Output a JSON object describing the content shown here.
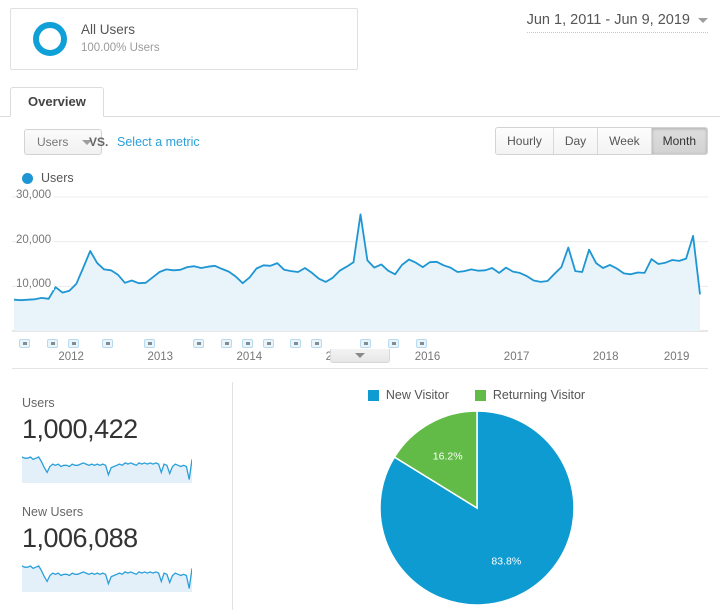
{
  "segment": {
    "name": "All Users",
    "subtitle": "100.00% Users",
    "ring_color": "#0fa0d8",
    "icon": "segment-ring-icon"
  },
  "date_range": {
    "label": "Jun 1, 2011 - Jun 9, 2019",
    "caret_icon": "chevron-down-icon"
  },
  "tabs": [
    {
      "label": "Overview",
      "active": true
    }
  ],
  "controls": {
    "metric_button": "Users",
    "metric_caret_icon": "chevron-down-icon",
    "vs_label": "VS.",
    "select_metric_link": "Select a metric",
    "granularity": [
      {
        "label": "Hourly",
        "active": false
      },
      {
        "label": "Day",
        "active": false
      },
      {
        "label": "Week",
        "active": false
      },
      {
        "label": "Month",
        "active": true
      }
    ]
  },
  "chart_data": {
    "type": "line",
    "title": "Users",
    "legend": [
      {
        "name": "Users",
        "color": "#1e96d3"
      }
    ],
    "legend_position": "top-left",
    "xlabel": "",
    "ylabel": "",
    "ylim": [
      0,
      30000
    ],
    "yticks": [
      "10,000",
      "20,000",
      "30,000"
    ],
    "ytick_values": [
      10000,
      20000,
      30000
    ],
    "grid": true,
    "xticks": [
      "2012",
      "2013",
      "2014",
      "2015",
      "2016",
      "2017",
      "2018",
      "2019"
    ],
    "x_start": "Jun 2011",
    "x_end": "Jun 2019",
    "area_fill": "#e8f3fa",
    "line_color": "#1e96d3",
    "values": [
      7000,
      6900,
      7000,
      7100,
      7400,
      7200,
      9800,
      8600,
      9000,
      10600,
      14200,
      17900,
      15200,
      13800,
      13600,
      12600,
      10800,
      11300,
      10700,
      10800,
      12000,
      13200,
      13800,
      13600,
      13700,
      14300,
      14500,
      14100,
      14400,
      14600,
      13900,
      13300,
      12200,
      10700,
      12000,
      14000,
      14700,
      14600,
      15200,
      13700,
      13400,
      13200,
      14100,
      13000,
      11700,
      11000,
      11900,
      13500,
      14400,
      15400,
      26100,
      15800,
      14200,
      14900,
      13500,
      12700,
      14800,
      16000,
      15300,
      14300,
      15400,
      15500,
      14700,
      14200,
      13200,
      13400,
      13800,
      13500,
      13600,
      14100,
      13000,
      14200,
      13300,
      13000,
      12300,
      11300,
      11000,
      11200,
      12800,
      14300,
      18700,
      13400,
      13200,
      18200,
      15200,
      14100,
      14800,
      14000,
      12900,
      12700,
      13100,
      13000,
      16100,
      15000,
      15300,
      15900,
      15700,
      16200,
      21300,
      8200
    ],
    "annotations_count": 14,
    "annotation_positions_pct": [
      1,
      5,
      8,
      13,
      19,
      26,
      30,
      33,
      36,
      40,
      43,
      50,
      54,
      58
    ],
    "collapse_control_icon": "chevron-down-icon"
  },
  "metric_cards": [
    {
      "name": "Users",
      "value": "1,000,422",
      "sparkline": [
        22,
        21,
        21,
        22,
        20,
        21,
        22,
        18,
        13,
        9,
        14,
        16,
        15,
        16,
        14,
        15,
        15,
        14,
        16,
        15,
        15,
        16,
        17,
        16,
        15,
        16,
        15,
        16,
        15,
        16,
        15,
        7,
        13,
        14,
        15,
        16,
        15,
        17,
        16,
        17,
        16,
        15,
        17,
        16,
        17,
        16,
        17,
        16,
        17,
        16,
        9,
        16,
        15,
        8,
        14,
        16,
        15,
        14,
        15,
        14,
        3,
        20
      ]
    },
    {
      "name": "New Users",
      "value": "1,006,088",
      "sparkline": [
        22,
        21,
        21,
        22,
        20,
        21,
        22,
        18,
        13,
        9,
        14,
        16,
        15,
        16,
        14,
        15,
        15,
        14,
        16,
        15,
        15,
        16,
        17,
        16,
        15,
        16,
        15,
        16,
        15,
        16,
        15,
        7,
        13,
        14,
        15,
        16,
        15,
        17,
        16,
        17,
        16,
        15,
        17,
        16,
        17,
        16,
        17,
        16,
        17,
        16,
        9,
        16,
        15,
        8,
        14,
        16,
        15,
        14,
        15,
        14,
        3,
        20
      ]
    }
  ],
  "pie_chart": {
    "type": "pie",
    "title": "",
    "labels": [
      "New Visitor",
      "Returning Visitor"
    ],
    "values": [
      83.8,
      16.2
    ],
    "value_labels": [
      "83.8%",
      "16.2%"
    ],
    "colors": [
      "#0e9bd1",
      "#62bb46"
    ],
    "legend_position": "top"
  }
}
